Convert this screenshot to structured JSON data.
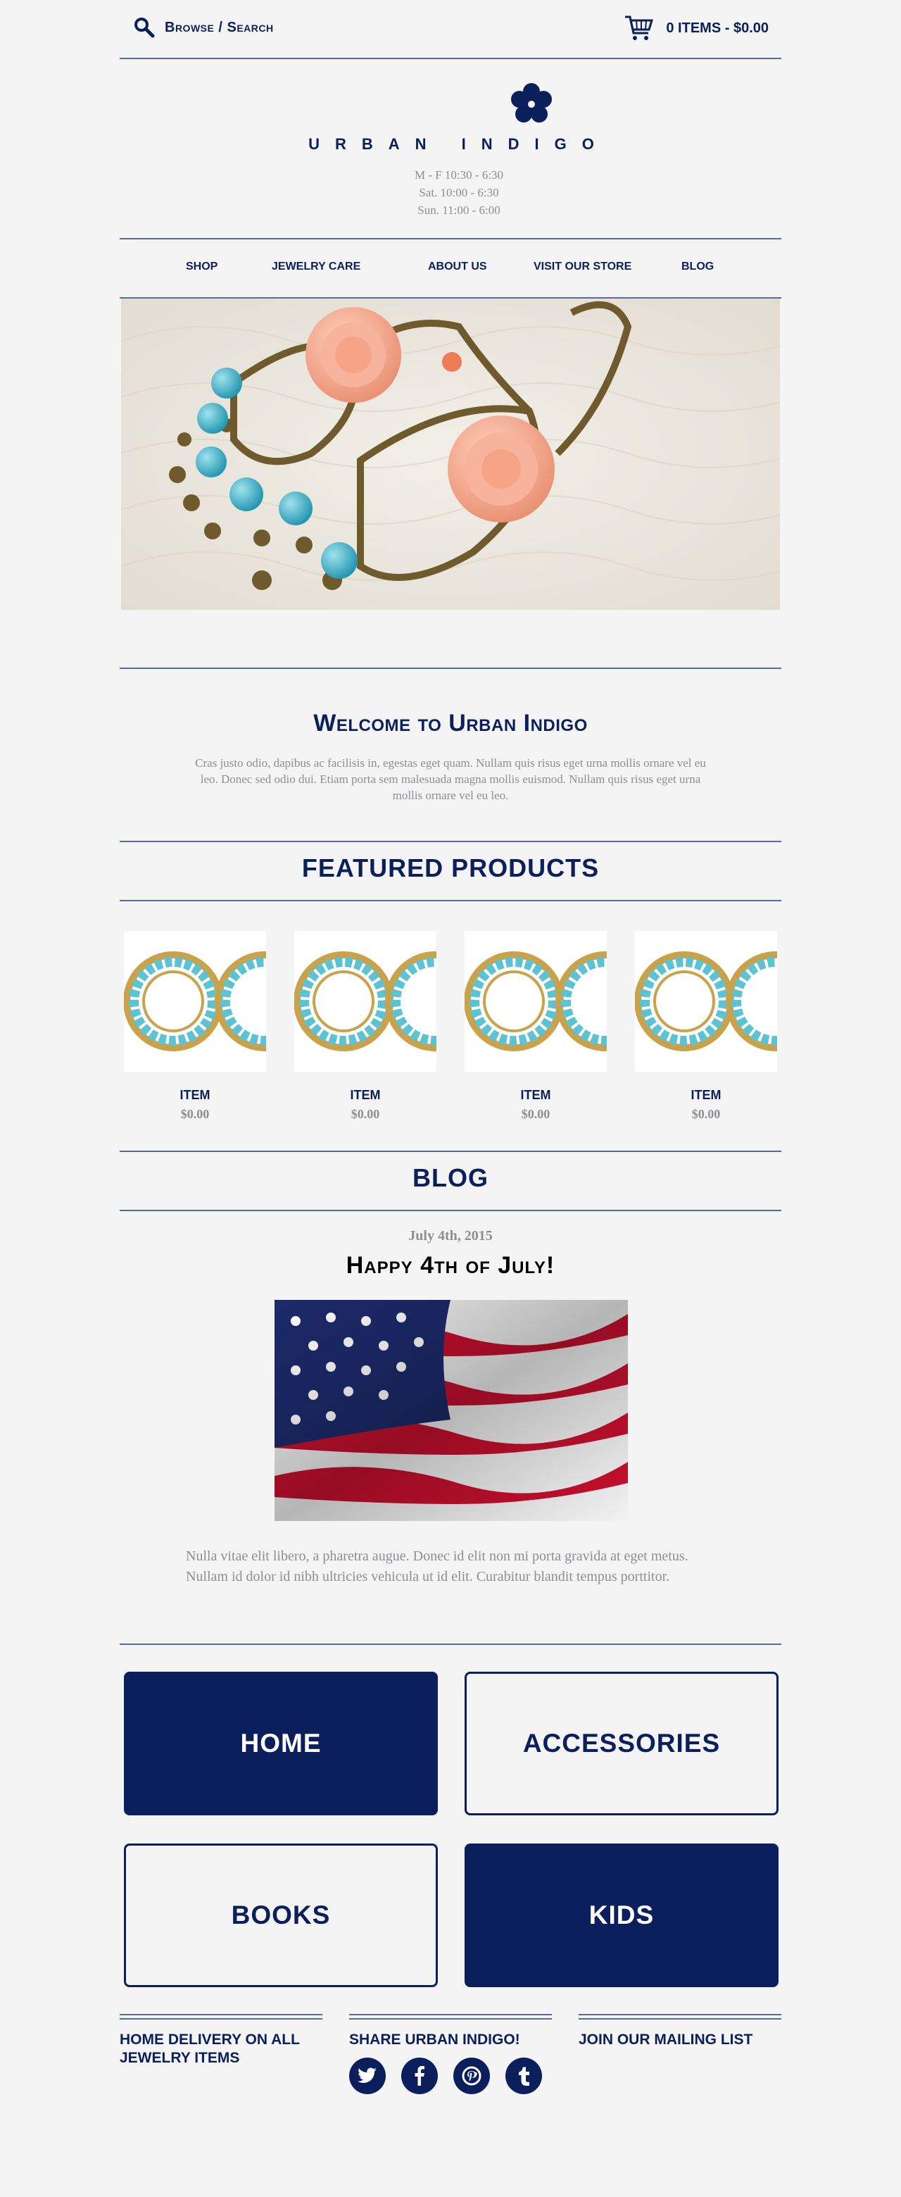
{
  "header": {
    "browse_label": "Browse / Search",
    "cart_label": "0 ITEMS - $0.00"
  },
  "brand": {
    "name": "URBAN INDIGO",
    "hours": [
      "M - F 10:30 - 6:30",
      "Sat. 10:00 - 6:30",
      "Sun. 11:00 - 6:00"
    ]
  },
  "nav": {
    "items": [
      "SHOP",
      "JEWELRY CARE",
      "ABOUT US",
      "VISIT OUR STORE",
      "BLOG"
    ]
  },
  "welcome": {
    "title": "Welcome to Urban Indigo",
    "body": "Cras justo odio, dapibus ac facilisis in, egestas eget quam. Nullam quis risus eget urna mollis ornare vel eu leo. Donec sed odio dui. Etiam porta sem malesuada magna mollis euismod. Nullam quis risus eget urna mollis ornare vel eu leo."
  },
  "featured": {
    "title": "FEATURED PRODUCTS",
    "products": [
      {
        "name": "ITEM",
        "price": "$0.00"
      },
      {
        "name": "ITEM",
        "price": "$0.00"
      },
      {
        "name": "ITEM",
        "price": "$0.00"
      },
      {
        "name": "ITEM",
        "price": "$0.00"
      }
    ]
  },
  "blog": {
    "title": "BLOG",
    "date": "July 4th, 2015",
    "post_title": "Happy 4th of July!",
    "body": "Nulla vitae elit libero, a pharetra augue. Donec id elit non mi porta gravida at eget metus. Nullam id dolor id nibh ultricies vehicula ut id elit. Curabitur blandit tempus porttitor."
  },
  "categories": [
    {
      "label": "HOME"
    },
    {
      "label": "ACCESSORIES"
    },
    {
      "label": "BOOKS"
    },
    {
      "label": "KIDS"
    }
  ],
  "footer": {
    "delivery": "HOME DELIVERY ON ALL JEWELRY ITEMS",
    "share": "SHARE URBAN INDIGO!",
    "mailing": "JOIN OUR MAILING LIST",
    "social_icons": [
      "twitter-icon",
      "facebook-icon",
      "pinterest-icon",
      "tumblr-icon"
    ]
  },
  "colors": {
    "brand_navy": "#0b1f5c",
    "background": "#f4f4f5",
    "muted_text": "#8e8e92"
  }
}
